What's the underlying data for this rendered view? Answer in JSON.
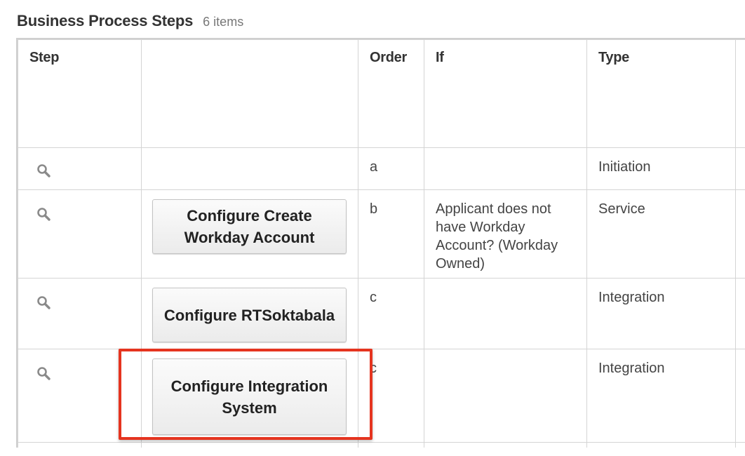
{
  "section": {
    "title": "Business Process Steps",
    "count": "6 items"
  },
  "columns": {
    "step": "Step",
    "button": "",
    "order": "Order",
    "if": "If",
    "type": "Type"
  },
  "rows": [
    {
      "button": "",
      "order": "a",
      "condition": "",
      "type": "Initiation"
    },
    {
      "button": "Configure Create Workday Account",
      "order": "b",
      "condition": "Applicant does not have Workday Account? (Workday Owned)",
      "type": "Service"
    },
    {
      "button": "Configure RTSoktabala",
      "order": "c",
      "condition": "",
      "type": "Integration"
    },
    {
      "button": "Configure Integration System",
      "order": "c",
      "condition": "",
      "type": "Integration"
    }
  ],
  "icons": {
    "step": "search-icon"
  },
  "colors": {
    "highlight": "#e5341f"
  }
}
